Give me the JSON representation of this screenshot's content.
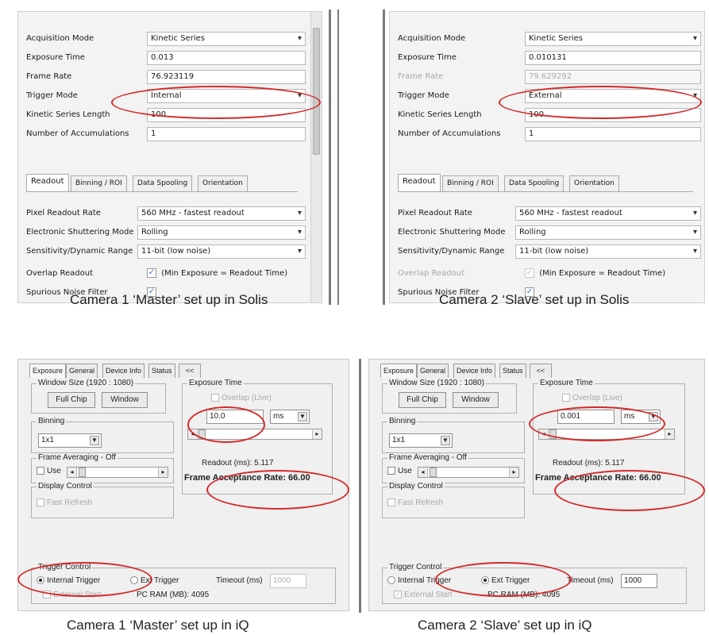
{
  "solis": {
    "master": {
      "fields": [
        {
          "label": "Acquisition Mode",
          "value": "Kinetic Series",
          "type": "combo",
          "disabled": false
        },
        {
          "label": "Exposure Time",
          "value": "0.013",
          "type": "text",
          "disabled": false
        },
        {
          "label": "Frame Rate",
          "value": "76.923119",
          "type": "text",
          "disabled": false
        },
        {
          "label": "Trigger Mode",
          "value": "Internal",
          "type": "combo",
          "disabled": false
        },
        {
          "label": "Kinetic Series Length",
          "value": "100",
          "type": "text",
          "disabled": false
        },
        {
          "label": "Number of Accumulations",
          "value": "1",
          "type": "text",
          "disabled": false
        }
      ],
      "tabs": [
        "Readout",
        "Binning / ROI",
        "Data Spooling",
        "Orientation"
      ],
      "readout": [
        {
          "label": "Pixel Readout Rate",
          "value": "560 MHz - fastest readout"
        },
        {
          "label": "Electronic Shuttering Mode",
          "value": "Rolling"
        },
        {
          "label": "Sensitivity/Dynamic Range",
          "value": "11-bit (low noise)"
        }
      ],
      "overlap_label": "Overlap Readout",
      "overlap_text": "(Min Exposure = Readout Time)",
      "noise_label": "Spurious Noise Filter",
      "check": "✓",
      "caption": "Camera 1 ‘Master’ set up in Solis"
    },
    "slave": {
      "fields": [
        {
          "label": "Acquisition Mode",
          "value": "Kinetic Series",
          "type": "combo",
          "disabled": false
        },
        {
          "label": "Exposure Time",
          "value": "0.010131",
          "type": "text",
          "disabled": false
        },
        {
          "label": "Frame Rate",
          "value": "79.629292",
          "type": "text",
          "disabled": true
        },
        {
          "label": "Trigger Mode",
          "value": "External",
          "type": "combo",
          "disabled": false
        },
        {
          "label": "Kinetic Series Length",
          "value": "100",
          "type": "text",
          "disabled": false
        },
        {
          "label": "Number of Accumulations",
          "value": "1",
          "type": "text",
          "disabled": false
        }
      ],
      "tabs": [
        "Readout",
        "Binning / ROI",
        "Data Spooling",
        "Orientation"
      ],
      "readout": [
        {
          "label": "Pixel Readout Rate",
          "value": "560 MHz - fastest readout"
        },
        {
          "label": "Electronic Shuttering Mode",
          "value": "Rolling"
        },
        {
          "label": "Sensitivity/Dynamic Range",
          "value": "11-bit (low noise)"
        }
      ],
      "overlap_label": "Overlap Readout",
      "overlap_text": "(Min Exposure = Readout Time)",
      "noise_label": "Spurious Noise Filter",
      "check": "✓",
      "caption": "Camera 2 ‘Slave’ set up in Solis"
    }
  },
  "iq": {
    "master": {
      "tabs": [
        "Exposure",
        "General",
        "Device Info",
        "Status",
        "<<"
      ],
      "window_size_title": "Window Size (1920 : 1080)",
      "full_chip": "Full Chip",
      "window": "Window",
      "binning_title": "Binning",
      "binning_value": "1x1",
      "frame_avg_title": "Frame Averaging - Off",
      "use_label": "Use",
      "display_title": "Display Control",
      "fast_refresh": "Fast Refresh",
      "exposure_title": "Exposure Time",
      "overlap_live": "Overlap (Live)",
      "exposure_value": "10.0",
      "unit": "ms",
      "readout": "Readout (ms): 5.117",
      "far_label": "Frame Acceptance Rate: 66.00",
      "trigger_title": "Trigger Control",
      "internal_trigger": "Internal Trigger",
      "ext_trigger": "Ext Trigger",
      "timeout_label": "Timeout (ms)",
      "timeout_value": "1000",
      "external_start": "External Start",
      "pc_ram": "PC RAM (MB): 4095",
      "caption": "Camera 1 ‘Master’ set up in iQ"
    },
    "slave": {
      "tabs": [
        "Exposure",
        "General",
        "Device Info",
        "Status",
        "<<"
      ],
      "window_size_title": "Window Size (1920 : 1080)",
      "full_chip": "Full Chip",
      "window": "Window",
      "binning_title": "Binning",
      "binning_value": "1x1",
      "frame_avg_title": "Frame Averaging - Off",
      "use_label": "Use",
      "display_title": "Display Control",
      "fast_refresh": "Fast Refresh",
      "exposure_title": "Exposure Time",
      "overlap_live": "Overlap (Live)",
      "exposure_value": "0.001",
      "unit": "ms",
      "readout": "Readout (ms): 5.117",
      "far_label": "Frame Acceptance Rate: 66.00",
      "trigger_title": "Trigger Control",
      "internal_trigger": "Internal Trigger",
      "ext_trigger": "Ext Trigger",
      "timeout_label": "Timeout (ms)",
      "timeout_value": "1000",
      "external_start": "External Start",
      "pc_ram": "PC RAM (MB): 4095",
      "caption": "Camera 2 ‘Slave’ set up in iQ"
    }
  },
  "colors": {
    "highlight_ring": "#d42a2a",
    "checkbox_blue": "#3b6dd8"
  }
}
